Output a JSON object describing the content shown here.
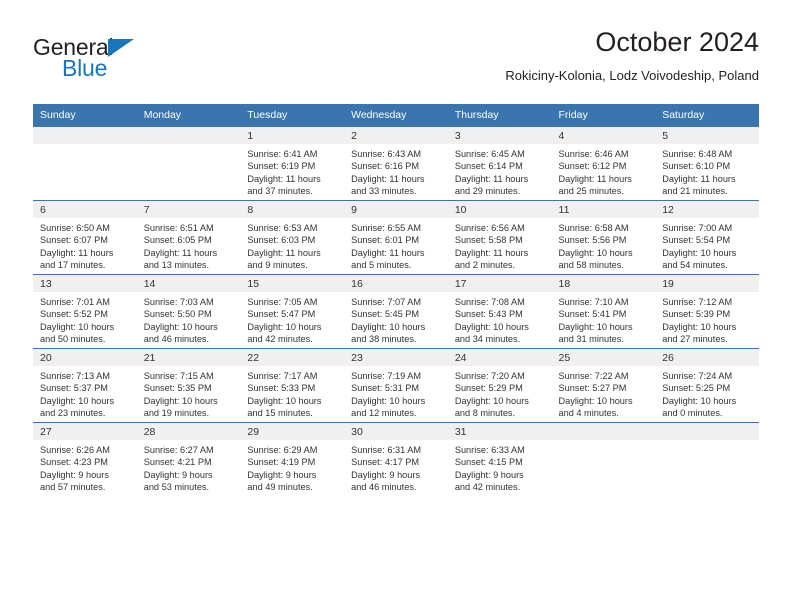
{
  "brand": {
    "name_top": "General",
    "name_bottom": "Blue",
    "triangle_icon": "triangle-icon",
    "color_top": "#231f20",
    "color_bottom": "#1a76bc"
  },
  "header": {
    "title": "October 2024",
    "subtitle": "Rokiciny-Kolonia, Lodz Voivodeship, Poland"
  },
  "theme": {
    "header_blue": "#3a75b0",
    "daynum_gray": "#f0f0f0",
    "text": "#333333"
  },
  "calendar": {
    "weekday_headers": [
      "Sunday",
      "Monday",
      "Tuesday",
      "Wednesday",
      "Thursday",
      "Friday",
      "Saturday"
    ],
    "weeks": [
      [
        {
          "day": "",
          "lines": []
        },
        {
          "day": "",
          "lines": []
        },
        {
          "day": "1",
          "lines": [
            "Sunrise: 6:41 AM",
            "Sunset: 6:19 PM",
            "Daylight: 11 hours",
            "and 37 minutes."
          ]
        },
        {
          "day": "2",
          "lines": [
            "Sunrise: 6:43 AM",
            "Sunset: 6:16 PM",
            "Daylight: 11 hours",
            "and 33 minutes."
          ]
        },
        {
          "day": "3",
          "lines": [
            "Sunrise: 6:45 AM",
            "Sunset: 6:14 PM",
            "Daylight: 11 hours",
            "and 29 minutes."
          ]
        },
        {
          "day": "4",
          "lines": [
            "Sunrise: 6:46 AM",
            "Sunset: 6:12 PM",
            "Daylight: 11 hours",
            "and 25 minutes."
          ]
        },
        {
          "day": "5",
          "lines": [
            "Sunrise: 6:48 AM",
            "Sunset: 6:10 PM",
            "Daylight: 11 hours",
            "and 21 minutes."
          ]
        }
      ],
      [
        {
          "day": "6",
          "lines": [
            "Sunrise: 6:50 AM",
            "Sunset: 6:07 PM",
            "Daylight: 11 hours",
            "and 17 minutes."
          ]
        },
        {
          "day": "7",
          "lines": [
            "Sunrise: 6:51 AM",
            "Sunset: 6:05 PM",
            "Daylight: 11 hours",
            "and 13 minutes."
          ]
        },
        {
          "day": "8",
          "lines": [
            "Sunrise: 6:53 AM",
            "Sunset: 6:03 PM",
            "Daylight: 11 hours",
            "and 9 minutes."
          ]
        },
        {
          "day": "9",
          "lines": [
            "Sunrise: 6:55 AM",
            "Sunset: 6:01 PM",
            "Daylight: 11 hours",
            "and 5 minutes."
          ]
        },
        {
          "day": "10",
          "lines": [
            "Sunrise: 6:56 AM",
            "Sunset: 5:58 PM",
            "Daylight: 11 hours",
            "and 2 minutes."
          ]
        },
        {
          "day": "11",
          "lines": [
            "Sunrise: 6:58 AM",
            "Sunset: 5:56 PM",
            "Daylight: 10 hours",
            "and 58 minutes."
          ]
        },
        {
          "day": "12",
          "lines": [
            "Sunrise: 7:00 AM",
            "Sunset: 5:54 PM",
            "Daylight: 10 hours",
            "and 54 minutes."
          ]
        }
      ],
      [
        {
          "day": "13",
          "lines": [
            "Sunrise: 7:01 AM",
            "Sunset: 5:52 PM",
            "Daylight: 10 hours",
            "and 50 minutes."
          ]
        },
        {
          "day": "14",
          "lines": [
            "Sunrise: 7:03 AM",
            "Sunset: 5:50 PM",
            "Daylight: 10 hours",
            "and 46 minutes."
          ]
        },
        {
          "day": "15",
          "lines": [
            "Sunrise: 7:05 AM",
            "Sunset: 5:47 PM",
            "Daylight: 10 hours",
            "and 42 minutes."
          ]
        },
        {
          "day": "16",
          "lines": [
            "Sunrise: 7:07 AM",
            "Sunset: 5:45 PM",
            "Daylight: 10 hours",
            "and 38 minutes."
          ]
        },
        {
          "day": "17",
          "lines": [
            "Sunrise: 7:08 AM",
            "Sunset: 5:43 PM",
            "Daylight: 10 hours",
            "and 34 minutes."
          ]
        },
        {
          "day": "18",
          "lines": [
            "Sunrise: 7:10 AM",
            "Sunset: 5:41 PM",
            "Daylight: 10 hours",
            "and 31 minutes."
          ]
        },
        {
          "day": "19",
          "lines": [
            "Sunrise: 7:12 AM",
            "Sunset: 5:39 PM",
            "Daylight: 10 hours",
            "and 27 minutes."
          ]
        }
      ],
      [
        {
          "day": "20",
          "lines": [
            "Sunrise: 7:13 AM",
            "Sunset: 5:37 PM",
            "Daylight: 10 hours",
            "and 23 minutes."
          ]
        },
        {
          "day": "21",
          "lines": [
            "Sunrise: 7:15 AM",
            "Sunset: 5:35 PM",
            "Daylight: 10 hours",
            "and 19 minutes."
          ]
        },
        {
          "day": "22",
          "lines": [
            "Sunrise: 7:17 AM",
            "Sunset: 5:33 PM",
            "Daylight: 10 hours",
            "and 15 minutes."
          ]
        },
        {
          "day": "23",
          "lines": [
            "Sunrise: 7:19 AM",
            "Sunset: 5:31 PM",
            "Daylight: 10 hours",
            "and 12 minutes."
          ]
        },
        {
          "day": "24",
          "lines": [
            "Sunrise: 7:20 AM",
            "Sunset: 5:29 PM",
            "Daylight: 10 hours",
            "and 8 minutes."
          ]
        },
        {
          "day": "25",
          "lines": [
            "Sunrise: 7:22 AM",
            "Sunset: 5:27 PM",
            "Daylight: 10 hours",
            "and 4 minutes."
          ]
        },
        {
          "day": "26",
          "lines": [
            "Sunrise: 7:24 AM",
            "Sunset: 5:25 PM",
            "Daylight: 10 hours",
            "and 0 minutes."
          ]
        }
      ],
      [
        {
          "day": "27",
          "lines": [
            "Sunrise: 6:26 AM",
            "Sunset: 4:23 PM",
            "Daylight: 9 hours",
            "and 57 minutes."
          ]
        },
        {
          "day": "28",
          "lines": [
            "Sunrise: 6:27 AM",
            "Sunset: 4:21 PM",
            "Daylight: 9 hours",
            "and 53 minutes."
          ]
        },
        {
          "day": "29",
          "lines": [
            "Sunrise: 6:29 AM",
            "Sunset: 4:19 PM",
            "Daylight: 9 hours",
            "and 49 minutes."
          ]
        },
        {
          "day": "30",
          "lines": [
            "Sunrise: 6:31 AM",
            "Sunset: 4:17 PM",
            "Daylight: 9 hours",
            "and 46 minutes."
          ]
        },
        {
          "day": "31",
          "lines": [
            "Sunrise: 6:33 AM",
            "Sunset: 4:15 PM",
            "Daylight: 9 hours",
            "and 42 minutes."
          ]
        },
        {
          "day": "",
          "lines": []
        },
        {
          "day": "",
          "lines": []
        }
      ]
    ]
  }
}
